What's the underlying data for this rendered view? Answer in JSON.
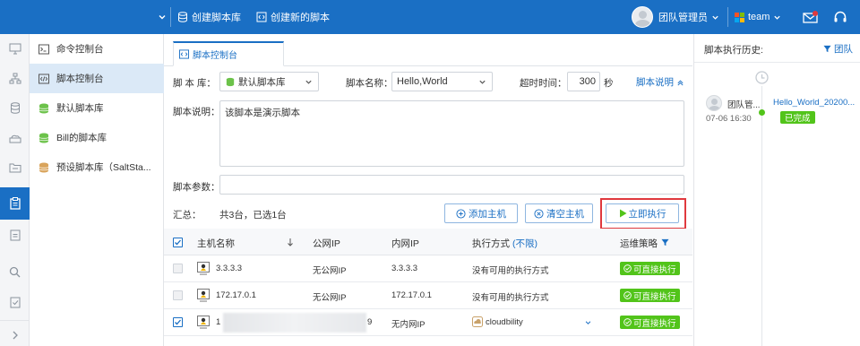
{
  "topbar": {
    "create_library": "创建脚本库",
    "create_script": "创建新的脚本",
    "user": "团队管理员",
    "team": "team"
  },
  "sidebar": {
    "items": [
      {
        "label": "命令控制台",
        "icon": "terminal-icon"
      },
      {
        "label": "脚本控制台",
        "icon": "code-icon"
      },
      {
        "label": "默认脚本库",
        "icon": "database-green-icon"
      },
      {
        "label": "Bill的脚本库",
        "icon": "database-green-icon"
      },
      {
        "label": "预设脚本库（SaltSta...",
        "icon": "database-tan-icon"
      }
    ]
  },
  "tab": {
    "label": "脚本控制台"
  },
  "form": {
    "library_label": "脚 本 库：",
    "library_value": "默认脚本库",
    "name_label": "脚本名称：",
    "name_value": "Hello,World",
    "timeout_label": "超时时间：",
    "timeout_value": "300",
    "timeout_unit": "秒",
    "desc_toggle": "脚本说明",
    "desc_label": "脚本说明：",
    "desc_value": "该脚本是演示脚本",
    "params_label": "脚本参数：",
    "params_value": ""
  },
  "summary": {
    "label": "汇总：",
    "text": "共3台，已选1台",
    "add_host": "添加主机",
    "clear_host": "清空主机",
    "run": "立即执行"
  },
  "table": {
    "headers": [
      "主机名称",
      "公网IP",
      "内网IP",
      "执行方式",
      "(不限)",
      "运维策略"
    ],
    "rows": [
      {
        "host": "3.3.3.3",
        "public_ip": "无公网IP",
        "private_ip": "3.3.3.3",
        "method": "没有可用的执行方式",
        "status": "可直接执行",
        "checked": false
      },
      {
        "host": "172.17.0.1",
        "public_ip": "无公网IP",
        "private_ip": "172.17.0.1",
        "method": "没有可用的执行方式",
        "status": "可直接执行",
        "checked": false
      },
      {
        "host": "1",
        "host_suffix": "9",
        "public_ip": "无内网IP",
        "private_ip": "",
        "method": "cloudbility",
        "status": "可直接执行",
        "checked": true
      }
    ]
  },
  "history": {
    "title": "脚本执行历史:",
    "filter": "团队",
    "entry": {
      "user": "团队管...",
      "time": "07-06 16:30",
      "script": "Hello_World_20200...",
      "status": "已完成"
    }
  },
  "colors": {
    "brand": "#1a6fc4",
    "success": "#52c41a",
    "highlight": "#e0393e"
  }
}
